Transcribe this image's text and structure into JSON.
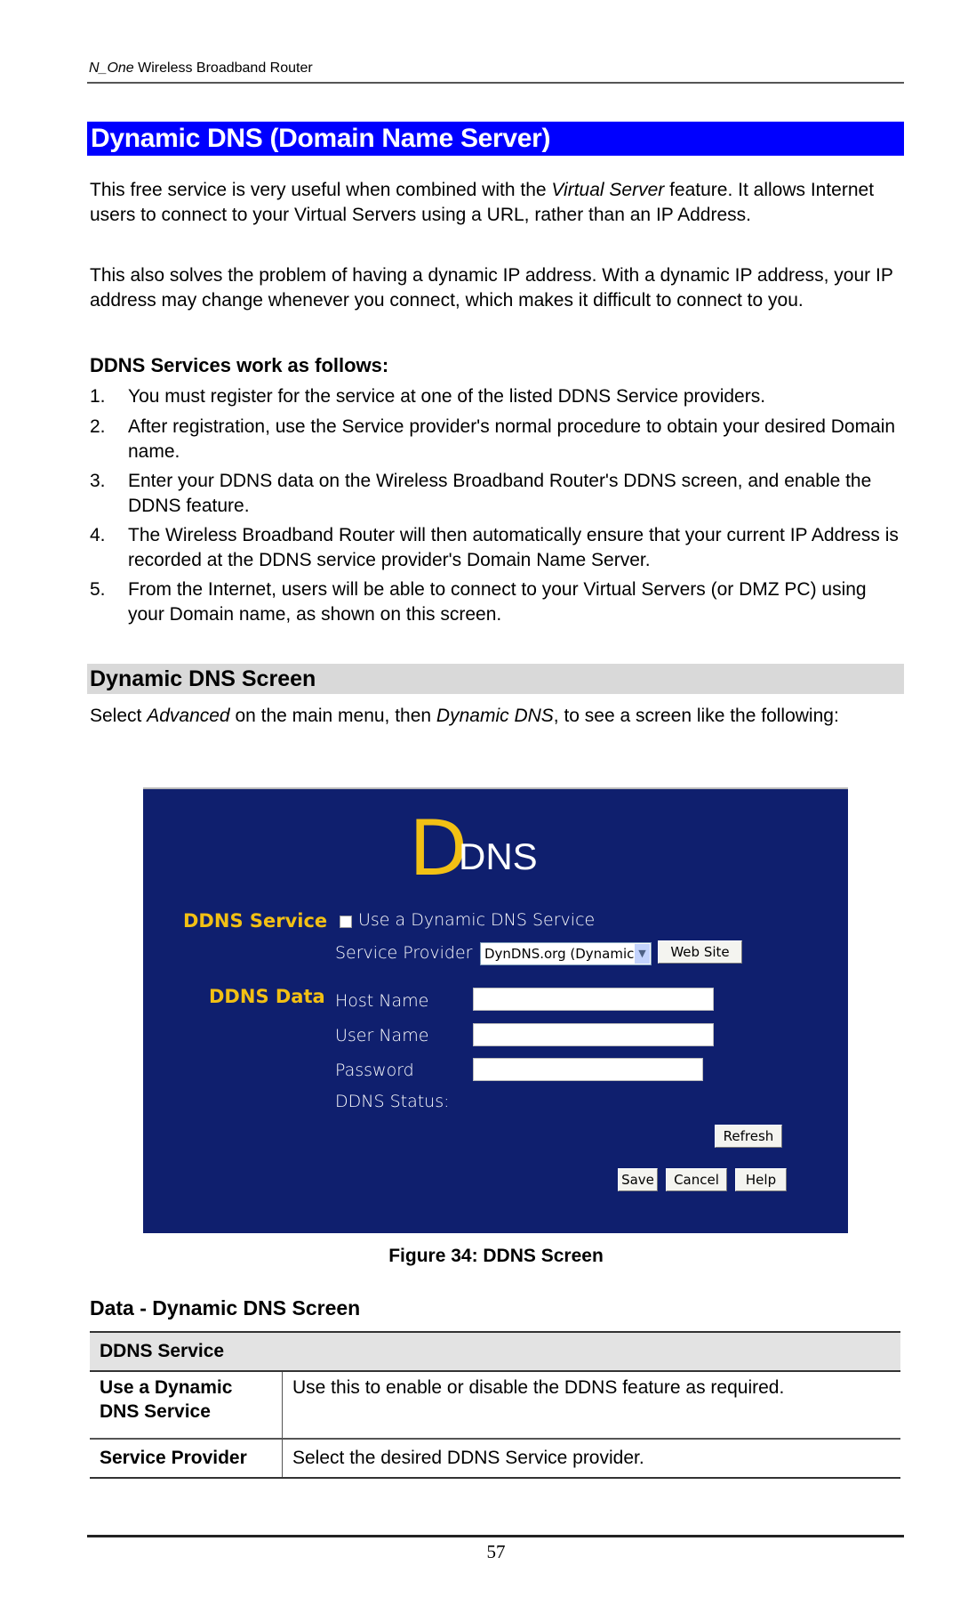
{
  "header": {
    "product_italic": "N_One",
    "product_rest": " Wireless Broadband Router"
  },
  "title": "Dynamic DNS (Domain Name Server)",
  "intro": {
    "p1_a": "This free service is very useful when combined with the ",
    "p1_italic": "Virtual Server",
    "p1_b": " feature. It allows Internet users to connect to your Virtual Servers using a URL, rather than an IP Address.",
    "p2": "This also solves the problem of having a dynamic IP address. With a dynamic IP address, your IP address may change whenever you connect, which makes it difficult to connect to you."
  },
  "how_it_works": {
    "heading": "DDNS Services work as follows:",
    "items": [
      {
        "num": "1.",
        "text": "You must register for the service at one of the listed DDNS Service providers."
      },
      {
        "num": "2.",
        "text": "After registration, use the Service provider's normal procedure to obtain your desired Domain name."
      },
      {
        "num": "3.",
        "text": "Enter your DDNS data on the Wireless Broadband Router's DDNS screen, and enable the DDNS feature."
      },
      {
        "num": "4.",
        "text": "The Wireless Broadband Router will then automatically ensure that your current IP Address is recorded at the DDNS service provider's Domain Name Server."
      },
      {
        "num": "5.",
        "text": "From the Internet, users will be able to connect to your Virtual Servers (or DMZ PC) using your Domain name, as shown on this screen."
      }
    ]
  },
  "screen_section": {
    "heading": "Dynamic DNS Screen",
    "text_a": "Select ",
    "italic_1": "Advanced",
    "text_b": " on the main menu, then ",
    "italic_2": "Dynamic DNS",
    "text_c": ", to see a screen like the following:"
  },
  "ddns_screen": {
    "logo_big": "D",
    "logo_small": "DNS",
    "service_label": "DDNS Service",
    "use_ddns_label": "Use a Dynamic DNS Service",
    "use_ddns_checked": false,
    "provider_label": "Service Provider",
    "provider_value": "DynDNS.org (Dynamic)",
    "web_site_button": "Web Site",
    "data_label": "DDNS Data",
    "host_name_label": "Host Name",
    "host_name_value": "",
    "user_name_label": "User Name",
    "user_name_value": "",
    "password_label": "Password",
    "password_value": "",
    "status_label": "DDNS Status:",
    "refresh_button": "Refresh",
    "save_button": "Save",
    "cancel_button": "Cancel",
    "help_button": "Help",
    "colors": {
      "background": "#0f1f6e",
      "accent": "#f2c014"
    }
  },
  "figure_caption": "Figure 34: DDNS Screen",
  "data_table": {
    "heading": "Data - Dynamic DNS Screen",
    "section": "DDNS Service",
    "rows": [
      {
        "field": "Use a Dynamic DNS Service",
        "description": "Use this to enable or disable the DDNS feature as required."
      },
      {
        "field": "Service Provider",
        "description": "Select the desired DDNS Service provider."
      }
    ]
  },
  "page_number": "57"
}
